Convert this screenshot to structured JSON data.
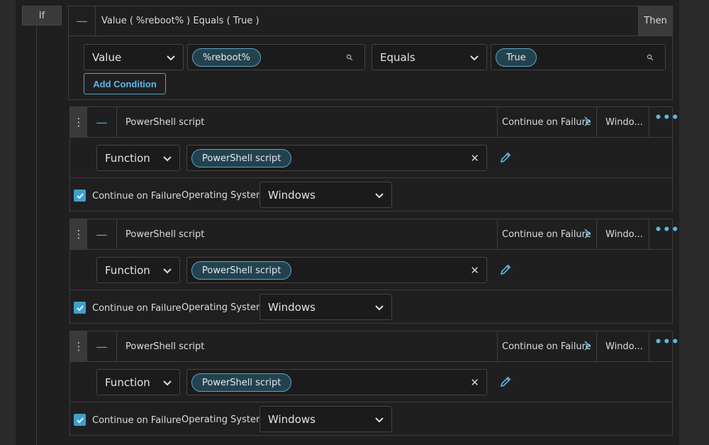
{
  "if_label": "If",
  "condition": {
    "title": "Value ( %reboot% ) Equals ( True )",
    "then_label": "Then",
    "field_select": "Value",
    "field_value": "%reboot%",
    "operator_select": "Equals",
    "compare_value": "True",
    "add_condition_label": "Add Condition"
  },
  "actions": [
    {
      "title": "PowerShell script",
      "failure_tab": "Continue on Failure",
      "os_tab": "Windo...",
      "type_select": "Function",
      "function_value": "PowerShell script",
      "continue_label": "Continue on Failure",
      "os_label": "Operating System:",
      "os_value": "Windows"
    },
    {
      "title": "PowerShell script",
      "failure_tab": "Continue on Failure",
      "os_tab": "Windo...",
      "type_select": "Function",
      "function_value": "PowerShell script",
      "continue_label": "Continue on Failure",
      "os_label": "Operating System:",
      "os_value": "Windows"
    },
    {
      "title": "PowerShell script",
      "failure_tab": "Continue on Failure",
      "os_tab": "Windo...",
      "type_select": "Function",
      "function_value": "PowerShell script",
      "continue_label": "Continue on Failure",
      "os_label": "Operating System:",
      "os_value": "Windows"
    }
  ],
  "colors": {
    "accent": "#4fb3e0",
    "background": "#1f1f1f",
    "pill_fill": "#23424f",
    "checkbox": "#3d9fd2"
  },
  "icons": [
    "minus-icon",
    "chevron-down-icon",
    "search-icon",
    "drag-handle-icon",
    "chevron-right-icon",
    "more-icon",
    "clear-icon",
    "pencil-icon",
    "check-icon"
  ]
}
